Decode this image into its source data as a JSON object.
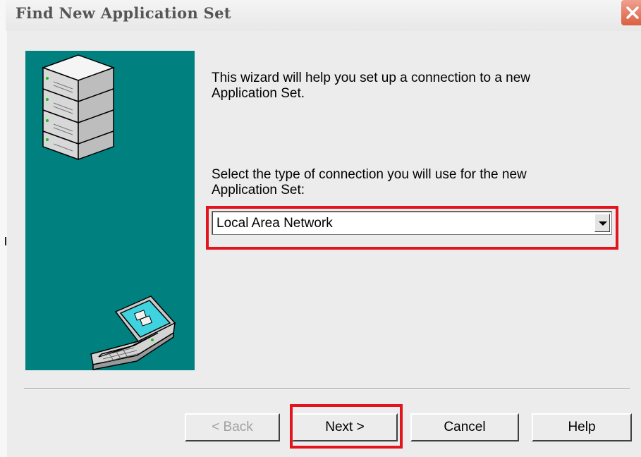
{
  "window": {
    "title": "Find New Application Set"
  },
  "wizard": {
    "intro_text": "This wizard will help you set up a connection to a new Application Set.",
    "prompt_text": "Select the type of connection you will use for the new Application Set:",
    "connection_type": {
      "selected_value": "Local Area Network"
    }
  },
  "buttons": {
    "back_label": "< Back",
    "next_label": "Next >",
    "cancel_label": "Cancel",
    "help_label": "Help"
  },
  "colors": {
    "side_panel": "#00807f",
    "highlight": "#e3141d"
  },
  "icons": {
    "side_panel_top": "server-stack-icon",
    "side_panel_bottom": "laptop-icon",
    "dropdown": "chevron-down-icon",
    "close": "close-icon"
  }
}
